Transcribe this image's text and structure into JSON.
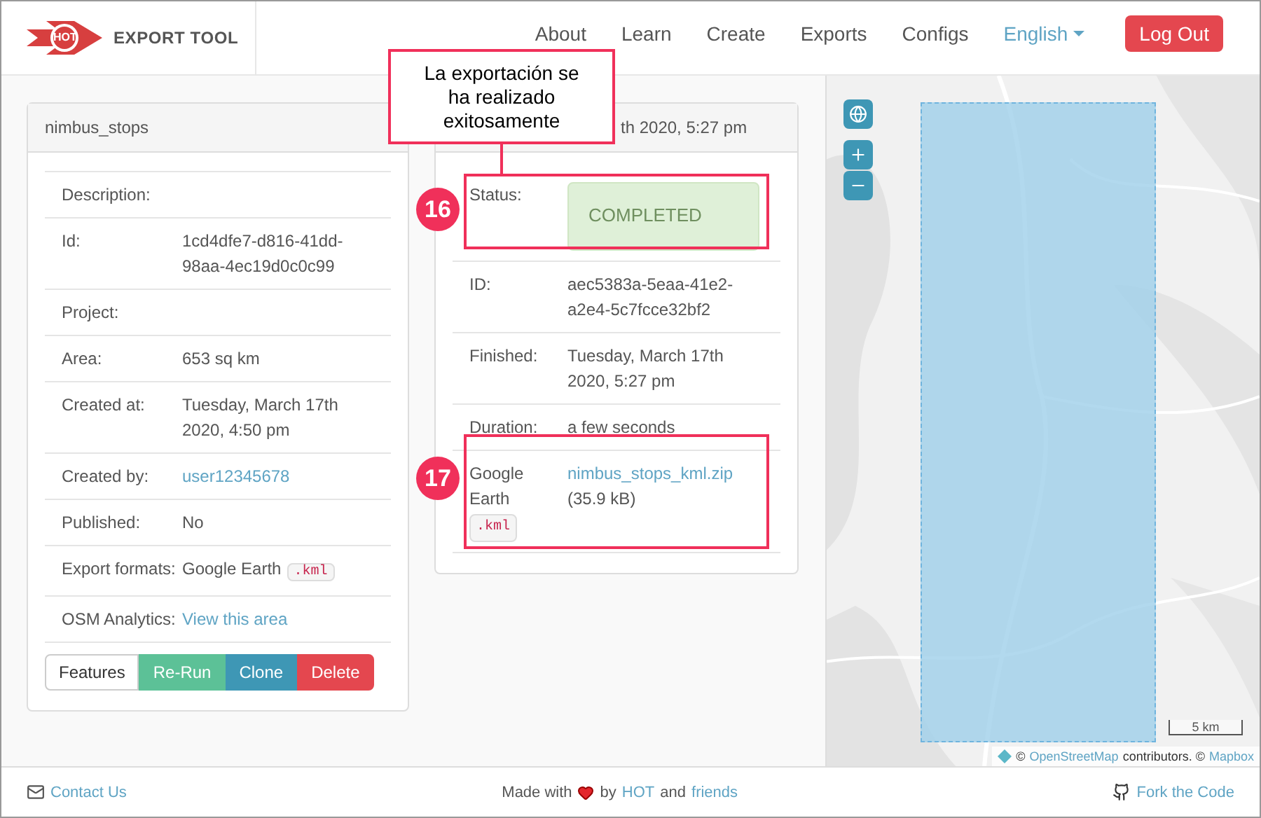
{
  "brand": {
    "logo_text": "HOT",
    "title": "EXPORT TOOL"
  },
  "nav": [
    {
      "label": "About",
      "kind": "link"
    },
    {
      "label": "Learn",
      "kind": "link"
    },
    {
      "label": "Create",
      "kind": "link"
    },
    {
      "label": "Exports",
      "kind": "link"
    },
    {
      "label": "Configs",
      "kind": "link"
    },
    {
      "label": "English",
      "kind": "dropdown"
    },
    {
      "label": "Log Out",
      "kind": "button"
    }
  ],
  "job_panel": {
    "title": "nimbus_stops",
    "rows": [
      {
        "label": "Description:",
        "value": "",
        "kind": "text"
      },
      {
        "label": "Id:",
        "value": "1cd4dfe7-d816-41dd-98aa-4ec19d0c0c99",
        "kind": "text"
      },
      {
        "label": "Project:",
        "value": "",
        "kind": "text"
      },
      {
        "label": "Area:",
        "value": "653 sq km",
        "kind": "text"
      },
      {
        "label": "Created at:",
        "value": "Tuesday, March 17th 2020, 4:50 pm",
        "kind": "text"
      },
      {
        "label": "Created by:",
        "value": "user12345678",
        "kind": "link"
      },
      {
        "label": "Published:",
        "value": "No",
        "kind": "text"
      },
      {
        "label": "Export formats:",
        "value": "Google Earth",
        "tag": ".kml",
        "kind": "text"
      },
      {
        "label": "OSM Analytics:",
        "value": "View this area",
        "kind": "link"
      }
    ],
    "buttons": [
      {
        "label": "Features",
        "kind": "default"
      },
      {
        "label": "Re-Run",
        "kind": "success"
      },
      {
        "label": "Clone",
        "kind": "info"
      },
      {
        "label": "Delete",
        "kind": "danger"
      }
    ]
  },
  "run_panel": {
    "title": "th 2020, 5:27 pm",
    "rows": [
      {
        "label": "Status:",
        "value": "COMPLETED",
        "kind": "status"
      },
      {
        "label": "ID:",
        "value": "aec5383a-5eaa-41e2-a2e4-5c7fcce32bf2",
        "kind": "text"
      },
      {
        "label": "Finished:",
        "value": "Tuesday, March 17th 2020, 5:27 pm",
        "kind": "text"
      },
      {
        "label": "Duration:",
        "value": "a few seconds",
        "kind": "text"
      },
      {
        "label": "Google Earth",
        "tag": ".kml",
        "value": "nimbus_stops_kml.zip",
        "size": "(35.9 kB)",
        "kind": "file"
      }
    ]
  },
  "map": {
    "scale": "5 km",
    "attribution": {
      "prefix": "©",
      "osm": "OpenStreetMap",
      "middle": "contributors. ©",
      "mapbox": "Mapbox"
    }
  },
  "footer": {
    "contact": "Contact Us",
    "made_with": "Made with",
    "by": "by",
    "hot": "HOT",
    "and": "and",
    "friends": "friends",
    "fork": "Fork the Code"
  },
  "annotations": {
    "callout": "La exportación se ha realizado exitosamente",
    "markers": [
      "16",
      "17"
    ]
  }
}
